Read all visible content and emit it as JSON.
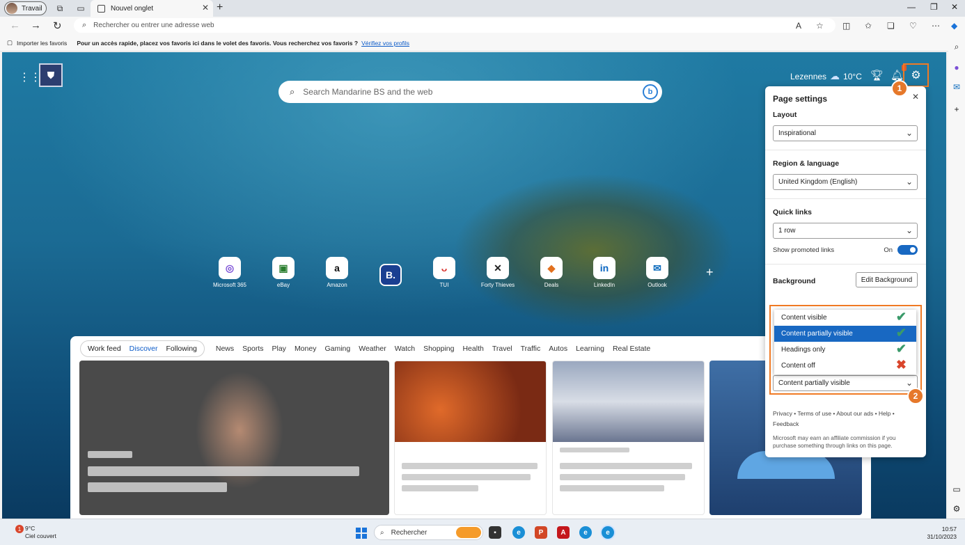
{
  "browser": {
    "profile_label": "Travail",
    "tab_title": "Nouvel onglet",
    "address_placeholder": "Rechercher ou entrer une adresse web",
    "favorites_import": "Importer les favoris",
    "favorites_message": "Pour un accès rapide, placez vos favoris ici dans le volet des favoris. Vous recherchez vos favoris ?",
    "favorites_link": "Vérifiez vos profils"
  },
  "header": {
    "location": "Lezennes",
    "temperature": "10°C",
    "search_placeholder": "Search Mandarine BS and the web",
    "bing_glyph": "b"
  },
  "quick_links": [
    {
      "label": "Microsoft 365",
      "glyph": "◎",
      "color": "#7b4fd6"
    },
    {
      "label": "eBay",
      "glyph": "▣",
      "color": "#2a7d2e"
    },
    {
      "label": "Amazon",
      "glyph": "a",
      "color": "#111111"
    },
    {
      "label": "",
      "glyph": "B.",
      "color": "#1a3f91"
    },
    {
      "label": "TUI",
      "glyph": "ᴗ",
      "color": "#d9302b"
    },
    {
      "label": "Forty Thieves",
      "glyph": "✕",
      "color": "#222222"
    },
    {
      "label": "Deals",
      "glyph": "◆",
      "color": "#e2701e"
    },
    {
      "label": "LinkedIn",
      "glyph": "in",
      "color": "#0a66c2"
    },
    {
      "label": "Outlook",
      "glyph": "✉",
      "color": "#0f6cbd"
    }
  ],
  "feed": {
    "pill_tabs": [
      "Work feed",
      "Discover",
      "Following"
    ],
    "active_tab": "Discover",
    "tabs": [
      "News",
      "Sports",
      "Play",
      "Money",
      "Gaming",
      "Weather",
      "Watch",
      "Shopping",
      "Health",
      "Travel",
      "Traffic",
      "Autos",
      "Learning",
      "Real Estate"
    ]
  },
  "settings": {
    "title": "Page settings",
    "layout_label": "Layout",
    "layout_value": "Inspirational",
    "region_label": "Region & language",
    "region_value": "United Kingdom (English)",
    "quick_links_label": "Quick links",
    "quick_links_value": "1 row",
    "promoted_label": "Show promoted links",
    "promoted_state": "On",
    "background_label": "Background",
    "edit_background": "Edit Background",
    "content_value": "Content partially visible",
    "content_options": [
      {
        "label": "Content visible",
        "mark": "✔"
      },
      {
        "label": "Content partially visible",
        "mark": "✔"
      },
      {
        "label": "Headings only",
        "mark": "✔"
      },
      {
        "label": "Content off",
        "mark": "✖"
      }
    ],
    "footer_links": "Privacy • Terms of use • About our ads • Help • Feedback",
    "footer_note": "Microsoft may earn an affiliate commission if you purchase something through links on this page."
  },
  "annotations": {
    "badge1": "1",
    "badge2": "2"
  },
  "taskbar": {
    "weather_temp": "9°C",
    "weather_desc": "Ciel couvert",
    "weather_badge": "1",
    "search_label": "Rechercher",
    "time": "10:57",
    "date": "31/10/2023"
  },
  "colors": {
    "accent": "#1868c2",
    "annotation": "#f07a24",
    "check": "#3a9a6a",
    "cross": "#d9452b"
  }
}
